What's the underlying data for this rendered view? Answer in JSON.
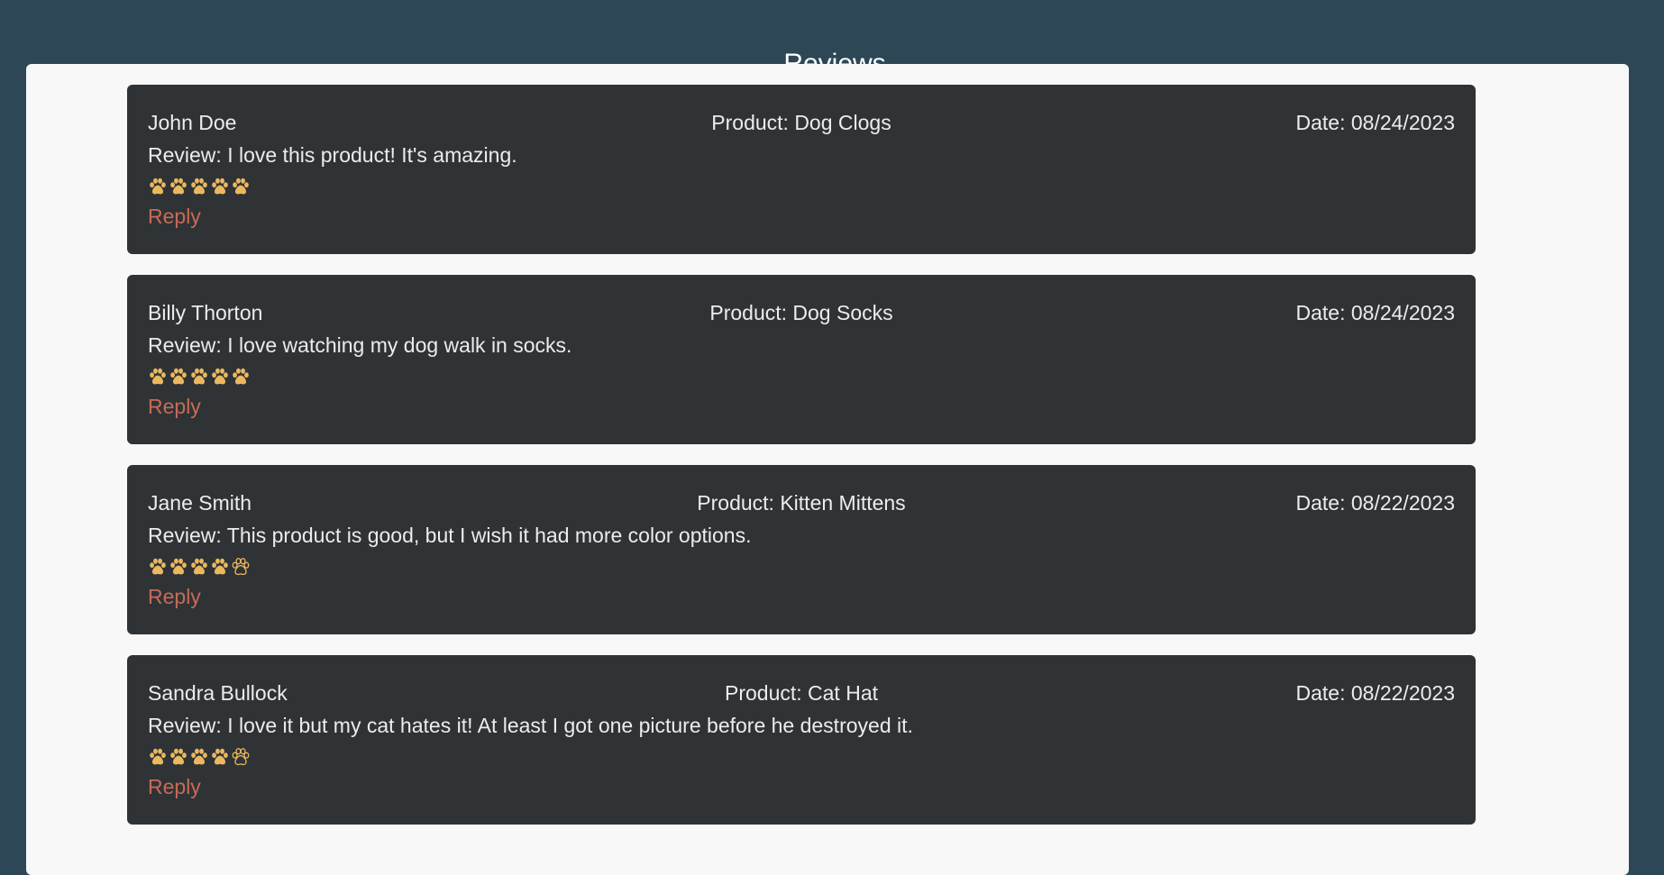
{
  "page": {
    "title": "Reviews"
  },
  "colors": {
    "background": "#2e4756",
    "panel": "#f8f8f8",
    "card": "#2f3336",
    "text": "#ececec",
    "paw": "#ebb85f",
    "reply": "#c96a55"
  },
  "reviews": [
    {
      "author": "John Doe",
      "product": "Product: Dog Clogs",
      "date": "Date: 08/24/2023",
      "review": "Review: I love this product! It's amazing.",
      "rating": 5,
      "max_rating": 5,
      "reply_label": "Reply"
    },
    {
      "author": "Billy Thorton",
      "product": "Product: Dog Socks",
      "date": "Date: 08/24/2023",
      "review": "Review: I love watching my dog walk in socks.",
      "rating": 5,
      "max_rating": 5,
      "reply_label": "Reply"
    },
    {
      "author": "Jane Smith",
      "product": "Product: Kitten Mittens",
      "date": "Date: 08/22/2023",
      "review": "Review: This product is good, but I wish it had more color options.",
      "rating": 4,
      "max_rating": 5,
      "reply_label": "Reply"
    },
    {
      "author": "Sandra Bullock",
      "product": "Product: Cat Hat",
      "date": "Date: 08/22/2023",
      "review": "Review: I love it but my cat hates it! At least I got one picture before he destroyed it.",
      "rating": 4,
      "max_rating": 5,
      "reply_label": "Reply"
    }
  ]
}
